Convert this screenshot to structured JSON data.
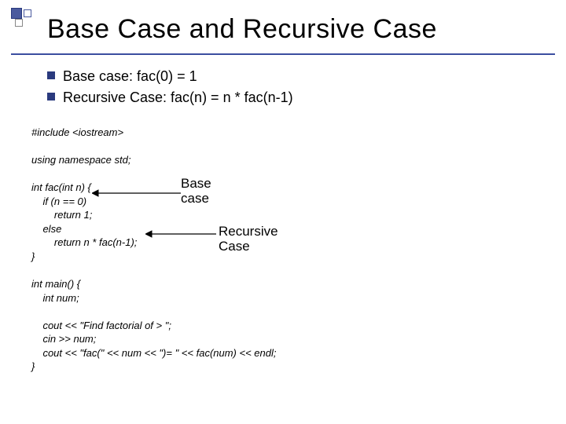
{
  "title": "Base Case and Recursive Case",
  "bullets": {
    "b1": "Base case: fac(0) = 1",
    "b2": "Recursive Case: fac(n) = n * fac(n-1)"
  },
  "code": {
    "l01": "#include <iostream>",
    "l02": "",
    "l03": "using namespace std;",
    "l04": "",
    "l05": "int fac(int n) {",
    "l06": "    if (n == 0)",
    "l07": "        return 1;",
    "l08": "    else",
    "l09": "        return n * fac(n-1);",
    "l10": "}",
    "l11": "",
    "l12": "int main() {",
    "l13": "    int num;",
    "l14": "",
    "l15": "    cout << \"Find factorial of > \";",
    "l16": "    cin >> num;",
    "l17": "    cout << \"fac(\" << num << \")= \" << fac(num) << endl;",
    "l18": "}"
  },
  "annotations": {
    "base_l1": "Base",
    "base_l2": "case",
    "rec_l1": "Recursive",
    "rec_l2": "Case"
  }
}
